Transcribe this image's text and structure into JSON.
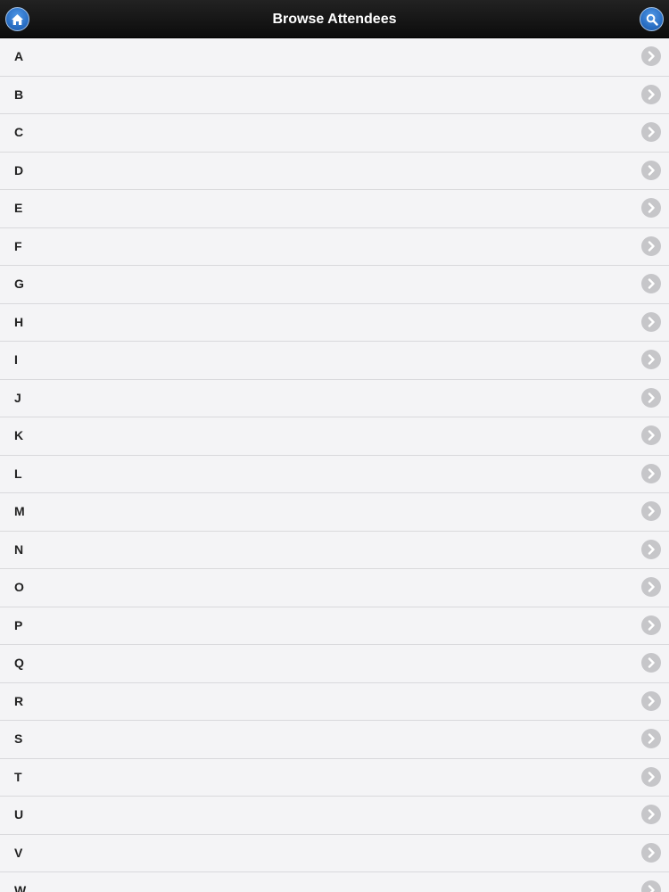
{
  "header": {
    "title": "Browse Attendees",
    "home_icon": "home-icon",
    "search_icon": "search-icon",
    "accent": "#2a6fc4"
  },
  "list": {
    "items": [
      {
        "label": "A"
      },
      {
        "label": "B"
      },
      {
        "label": "C"
      },
      {
        "label": "D"
      },
      {
        "label": "E"
      },
      {
        "label": "F"
      },
      {
        "label": "G"
      },
      {
        "label": "H"
      },
      {
        "label": "I"
      },
      {
        "label": "J"
      },
      {
        "label": "K"
      },
      {
        "label": "L"
      },
      {
        "label": "M"
      },
      {
        "label": "N"
      },
      {
        "label": "O"
      },
      {
        "label": "P"
      },
      {
        "label": "Q"
      },
      {
        "label": "R"
      },
      {
        "label": "S"
      },
      {
        "label": "T"
      },
      {
        "label": "U"
      },
      {
        "label": "V"
      },
      {
        "label": "W"
      }
    ],
    "row_icon": "chevron-right-icon"
  }
}
